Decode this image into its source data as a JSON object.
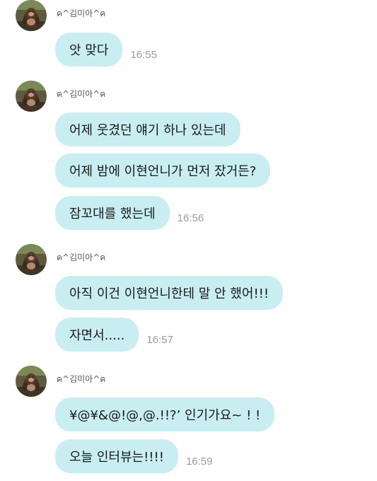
{
  "colors": {
    "bubble": "#c8eef2",
    "bubble_text": "#1a1a1a",
    "time_text": "#9a9a9a",
    "sender_text": "#555555",
    "background": "#ffffff"
  },
  "groups": [
    {
      "sender": "ค^김미아^ค",
      "avatar_icon": "monkey-avatar-icon",
      "messages": [
        {
          "text": "앗 맞다",
          "time": "16:55"
        }
      ]
    },
    {
      "sender": "ค^김미아^ค",
      "avatar_icon": "monkey-avatar-icon",
      "messages": [
        {
          "text": "어제 웃겼던 얘기 하나 있는데",
          "time": ""
        },
        {
          "text": "어제 밤에 이현언니가 먼저 잤거든?",
          "time": ""
        },
        {
          "text": "잠꼬대를 했는데",
          "time": "16:56"
        }
      ]
    },
    {
      "sender": "ค^김미아^ค",
      "avatar_icon": "monkey-avatar-icon",
      "messages": [
        {
          "text": "아직 이건 이현언니한테 말 안 했어!!!",
          "time": ""
        },
        {
          "text": "자면서.....",
          "time": "16:57"
        }
      ]
    },
    {
      "sender": "ค^김미아^ค",
      "avatar_icon": "monkey-avatar-icon",
      "messages": [
        {
          "text": "¥@¥&@!@,@.!!?’ 인기가요~ ! !",
          "time": ""
        },
        {
          "text": "오늘 인터뷰는!!!!",
          "time": "16:59"
        }
      ]
    }
  ]
}
